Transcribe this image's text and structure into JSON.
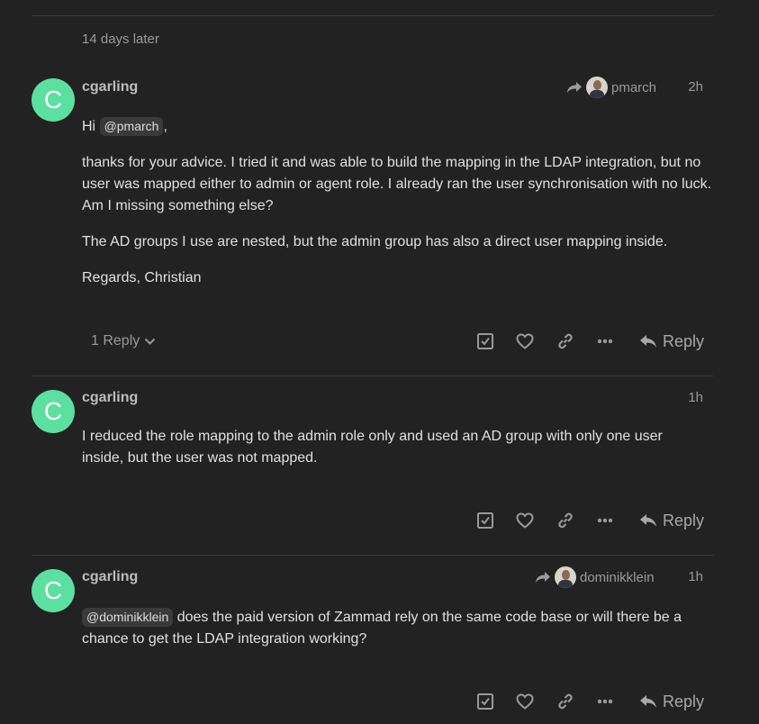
{
  "time_gap": "14 days later",
  "posts": [
    {
      "username": "cgarling",
      "avatar_letter": "C",
      "reply_to": "pmarch",
      "time": "2h",
      "greeting": "Hi",
      "mention": "@pmarch",
      "greeting_suffix": ",",
      "paragraphs": [
        "thanks for your advice. I tried it and was able to build the mapping in the LDAP integration, but no user was mapped either to admin or agent role. I already ran the user synchronisation with no luck. Am I missing something else?",
        "The AD groups I use are nested, but the admin group has also a direct user mapping inside.",
        "Regards, Christian"
      ],
      "replies_label": "1 Reply",
      "reply_label": "Reply"
    },
    {
      "username": "cgarling",
      "avatar_letter": "C",
      "time": "1h",
      "paragraphs": [
        "I reduced the role mapping to the admin role only and used an AD group with only one user inside, but the user was not mapped."
      ],
      "reply_label": "Reply"
    },
    {
      "username": "cgarling",
      "avatar_letter": "C",
      "reply_to": "dominikklein",
      "time": "1h",
      "mention": "@dominikklein",
      "text": "does the paid version of Zammad rely on the same code base or will there be a chance to get the LDAP integration working?",
      "reply_label": "Reply"
    }
  ],
  "colors": {
    "background": "#222222",
    "avatar": "#5ce0a1",
    "muted": "#9a9a9a",
    "text": "#e0e0e0"
  }
}
